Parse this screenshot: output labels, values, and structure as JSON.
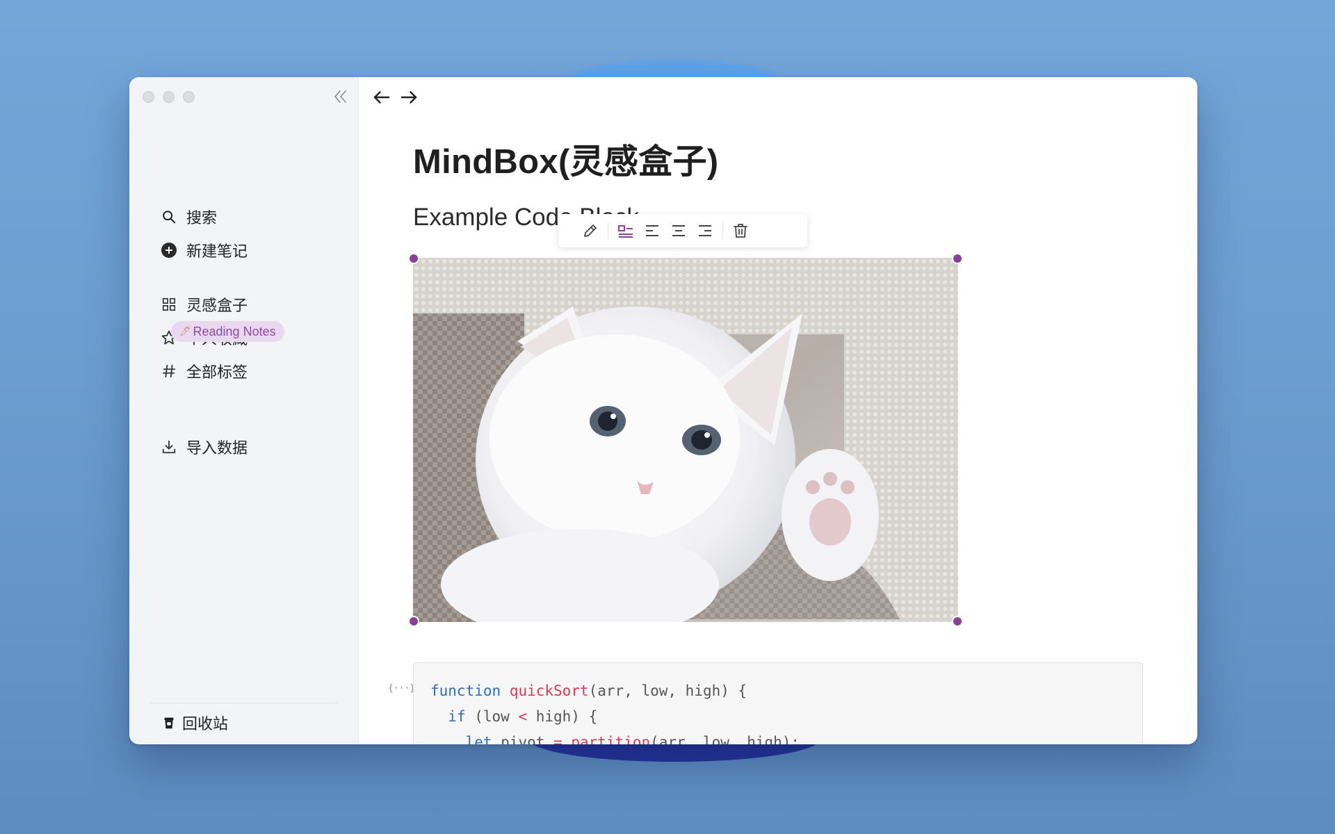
{
  "window": {
    "controls": [
      "close",
      "minimize",
      "maximize"
    ]
  },
  "sidebar": {
    "collapse_icon": "double-chevron-left-icon",
    "items": [
      {
        "label": "搜索",
        "icon": "search-icon"
      },
      {
        "label": "新建笔记",
        "icon": "plus-circle-icon"
      },
      {
        "label": "灵感盒子",
        "icon": "grid-icon"
      },
      {
        "label": "个人收藏",
        "icon": "star-icon"
      },
      {
        "label": "全部标签",
        "icon": "hash-icon"
      },
      {
        "label": "导入数据",
        "icon": "download-icon"
      }
    ],
    "tag": {
      "emoji": "🖊",
      "label": "Reading Notes",
      "color": "#8b4a9f",
      "background": "#ead8f1"
    },
    "trash": {
      "label": "回收站",
      "icon": "trash-icon"
    }
  },
  "editor": {
    "title": "MindBox(灵感盒子)",
    "heading": "Example Code Block",
    "image_toolbar": [
      "pencil-icon",
      "inline-layout-icon",
      "align-left-icon",
      "align-center-icon",
      "align-right-icon",
      "delete-icon"
    ],
    "image": {
      "subject": "white kitten",
      "selection_color": "#8b3f99"
    },
    "code": {
      "lines": [
        "function quickSort(arr, low, high) {",
        "  if (low < high) {",
        "    let pivot = partition(arr, low, high);"
      ]
    }
  },
  "colors": {
    "accent": "#8b3f99",
    "keyword": "#2e6fb0",
    "function": "#cf3c57"
  }
}
